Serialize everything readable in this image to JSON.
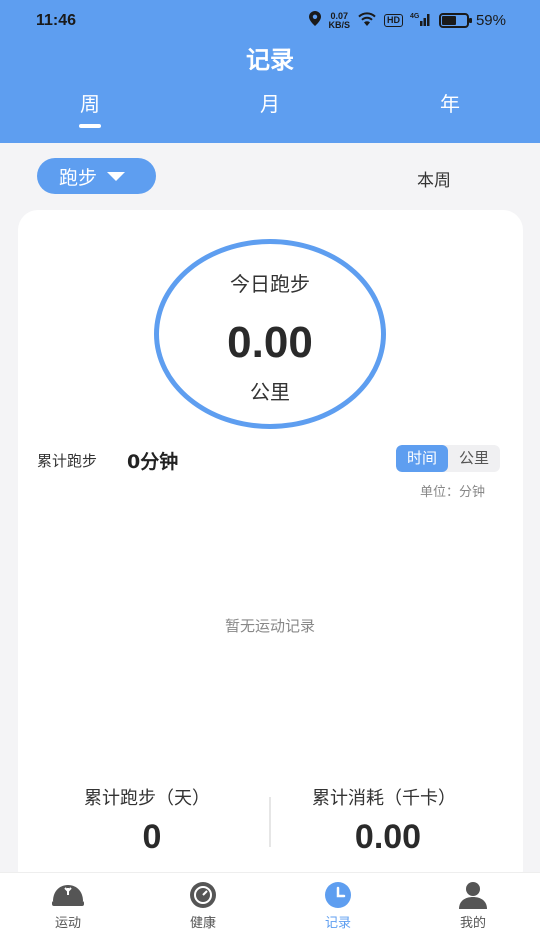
{
  "status_bar": {
    "time": "11:46",
    "speed_value": "0.07",
    "speed_unit": "KB/S",
    "hd": "HD",
    "network": "4G",
    "battery_level": 0.59,
    "battery_percent": "59%"
  },
  "header": {
    "title": "记录",
    "tabs": [
      {
        "label": "周",
        "active": true
      },
      {
        "label": "月",
        "active": false
      },
      {
        "label": "年",
        "active": false
      }
    ]
  },
  "filter": {
    "sport": "跑步",
    "period": "本周"
  },
  "summary": {
    "ring_title": "今日跑步",
    "ring_value": "0.00",
    "ring_unit": "公里"
  },
  "chart_section": {
    "total_label": "累计跑步",
    "total_value": "0分钟",
    "toggle": [
      {
        "label": "时间",
        "active": true
      },
      {
        "label": "公里",
        "active": false
      }
    ],
    "unit_note": "单位：分钟",
    "empty_text": "暂无运动记录"
  },
  "stats": {
    "days_label": "累计跑步（天）",
    "days_value": "0",
    "calories_label": "累计消耗（千卡）",
    "calories_value": "0.00"
  },
  "bottom_nav": [
    {
      "label": "运动",
      "icon": "running-shoe-icon",
      "active": false
    },
    {
      "label": "健康",
      "icon": "health-scale-icon",
      "active": false
    },
    {
      "label": "记录",
      "icon": "clock-icon",
      "active": true
    },
    {
      "label": "我的",
      "icon": "person-icon",
      "active": false
    }
  ],
  "colors": {
    "accent": "#5e9ef0",
    "background": "#f4f4f6"
  }
}
